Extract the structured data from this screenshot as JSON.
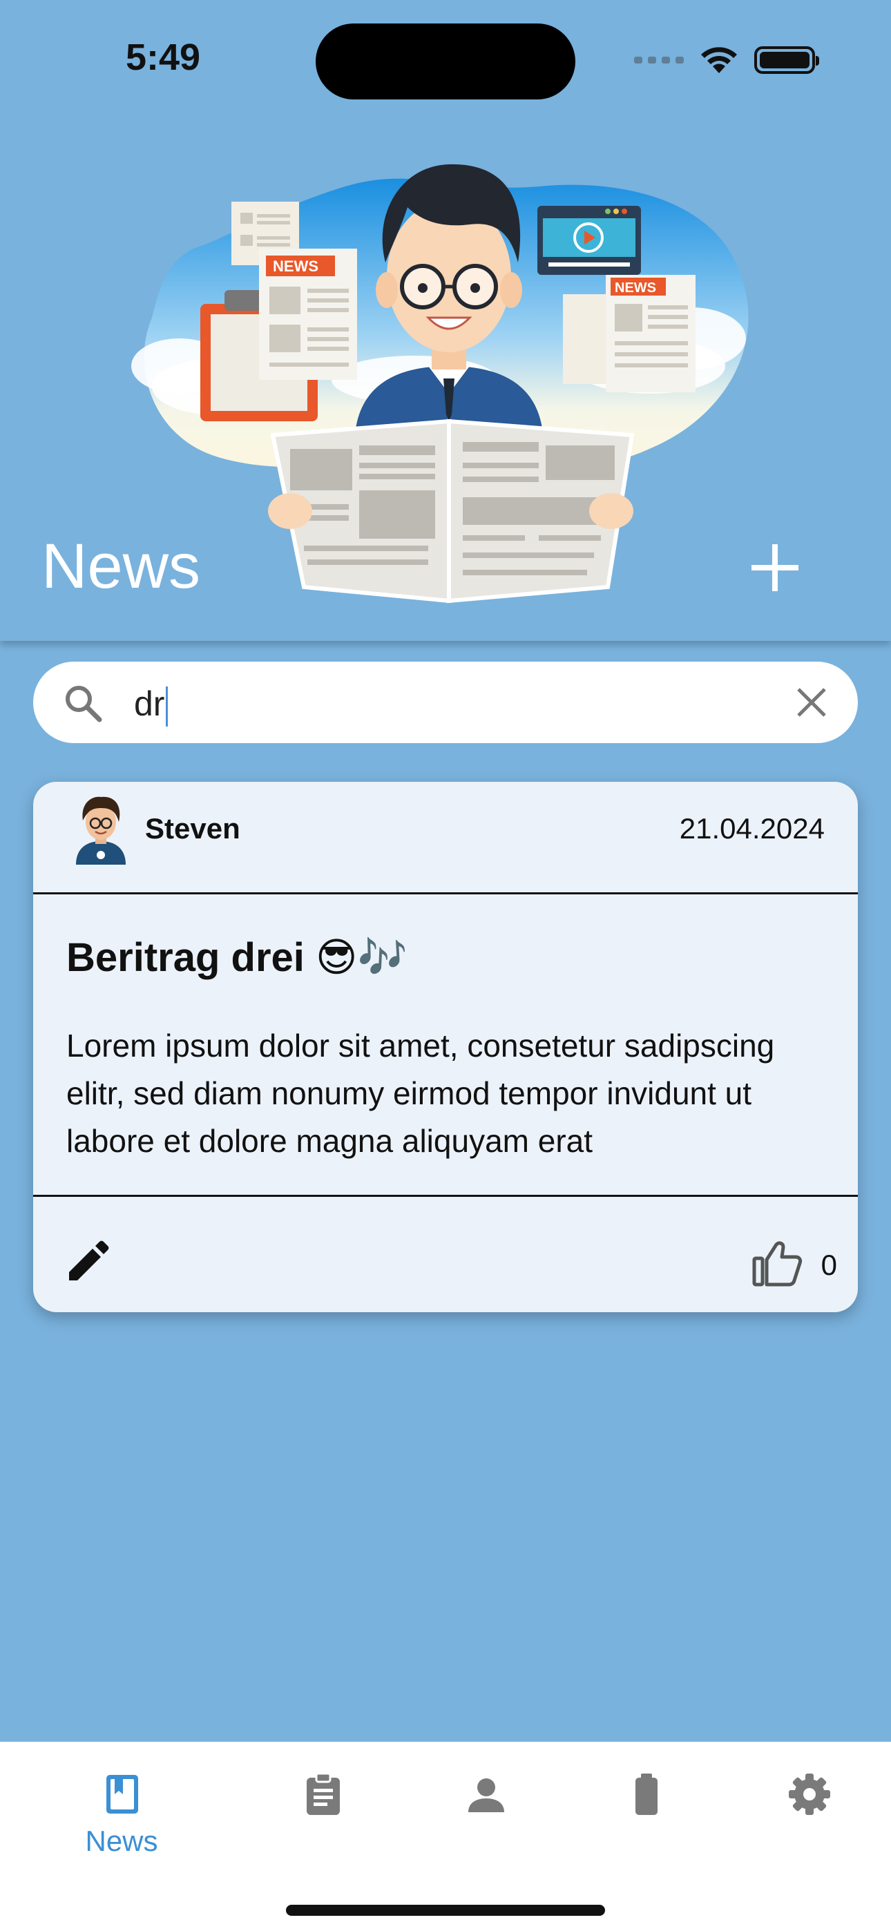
{
  "status_bar": {
    "time": "5:49"
  },
  "header": {
    "title": "News"
  },
  "search": {
    "value": "dr",
    "placeholder": ""
  },
  "post": {
    "author": "Steven",
    "date": "21.04.2024",
    "title": "Beritrag drei 😎🎶",
    "body": "Lorem ipsum dolor sit amet, consetetur sadipscing elitr, sed diam nonumy eirmod tempor invidunt ut labore et dolore magna aliquyam erat",
    "likes": "0"
  },
  "nav": {
    "items": [
      {
        "label": "News",
        "icon": "bookmark-book-icon",
        "active": true
      },
      {
        "label": "",
        "icon": "clipboard-icon",
        "active": false
      },
      {
        "label": "",
        "icon": "person-icon",
        "active": false
      },
      {
        "label": "",
        "icon": "battery-icon",
        "active": false
      },
      {
        "label": "",
        "icon": "gear-icon",
        "active": false
      }
    ]
  },
  "colors": {
    "background": "#79b2dd",
    "card": "#ecf2f9",
    "accent": "#3a8fd5",
    "nav_inactive": "#7a7a7a"
  }
}
